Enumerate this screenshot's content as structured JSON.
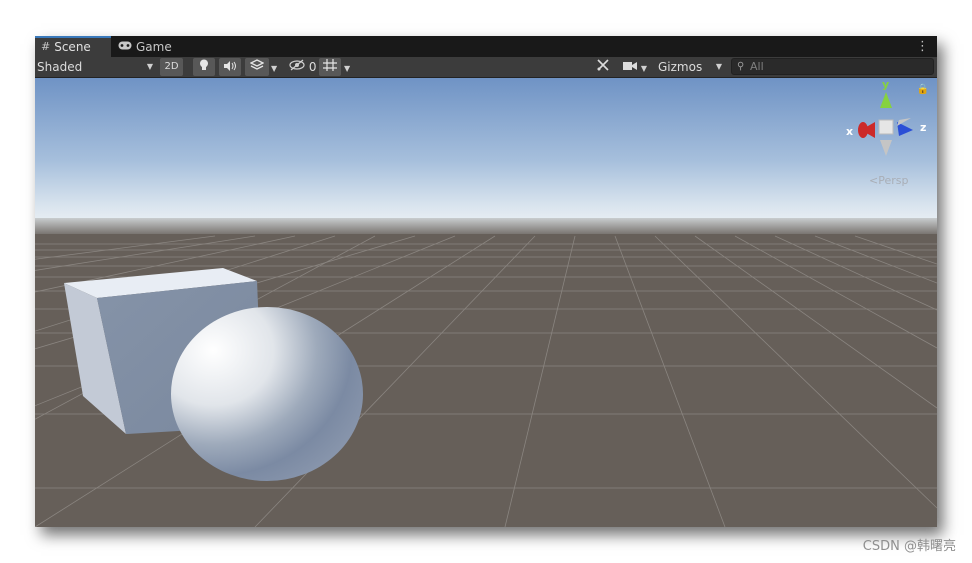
{
  "tabs": [
    {
      "label": "Scene",
      "icon": "grid-icon",
      "active": true
    },
    {
      "label": "Game",
      "icon": "gamepad-icon",
      "active": false
    }
  ],
  "toolbar": {
    "draw_mode": "Shaded",
    "mode_2d": "2D",
    "hidden_count": "0",
    "gizmos_label": "Gizmos",
    "search_placeholder": "All"
  },
  "gizmo": {
    "x_label": "x",
    "y_label": "y",
    "z_label": "z",
    "projection": "Persp"
  },
  "watermark": "CSDN @韩曙亮",
  "colors": {
    "x_axis": "#cc2a2a",
    "y_axis": "#86d23f",
    "z_axis": "#2b4fd6",
    "sky_top": "#6f93c5",
    "ground": "#665f59",
    "active_tab_accent": "#3a79bb"
  }
}
